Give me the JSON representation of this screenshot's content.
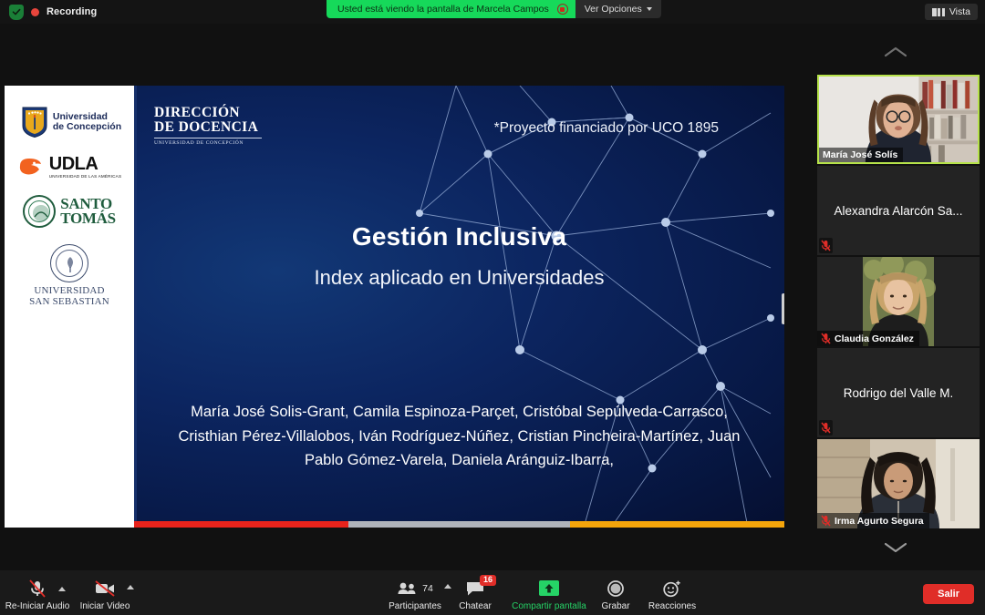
{
  "topbar": {
    "recording_label": "Recording",
    "shield_icon": "security-shield-icon",
    "share_banner_text": "Usted está viendo la pantalla de Marcela Campos",
    "stop_share_icon": "stop-share-icon",
    "view_options_label": "Ver Opciones",
    "view_button_label": "Vista"
  },
  "slide": {
    "logos": [
      {
        "name": "Universidad de Concepción",
        "line1": "Universidad",
        "line2": "de Concepción"
      },
      {
        "name": "UDLA",
        "word": "UDLA",
        "sub": "UNIVERSIDAD DE LAS AMÉRICAS"
      },
      {
        "name": "Santo Tomás",
        "line1": "SANTO",
        "line2": "TOMÁS"
      },
      {
        "name": "Universidad San Sebastián",
        "line1": "UNIVERSIDAD",
        "line2": "SAN SEBASTIAN"
      }
    ],
    "dd_logo_line1": "DIRECCIÓN",
    "dd_logo_line2": "DE DOCENCIA",
    "dd_logo_sub": "UNIVERSIDAD DE CONCEPCIÓN",
    "funding_note": "*Proyecto financiado por UCO 1895",
    "title": "Gestión Inclusiva",
    "subtitle": "Index aplicado en Universidades",
    "authors": "María José Solis-Grant, Camila Espinoza-Parçet, Cristóbal Sepúlveda-Carrasco, Cristhian Pérez-Villalobos, Iván Rodríguez-Núñez, Cristian Pincheira-Martínez, Juan Pablo Gómez-Varela, Daniela Aránguiz-Ibarra,",
    "accent_colors": {
      "red": "#e8231c",
      "gray": "#b0b4bb",
      "amber": "#f4a50b",
      "slide_blue": "#0c2560"
    }
  },
  "participants_panel": {
    "scroll_up_icon": "chevron-up-icon",
    "scroll_down_icon": "chevron-down-icon",
    "tiles": [
      {
        "name": "María José Solís",
        "speaking": true,
        "muted": false,
        "has_video": true
      },
      {
        "name": "Alexandra Alarcón Sa...",
        "speaking": false,
        "muted": true,
        "has_video": false
      },
      {
        "name": "Claudia González",
        "speaking": false,
        "muted": true,
        "has_video": true
      },
      {
        "name": "Rodrigo del Valle M.",
        "speaking": false,
        "muted": true,
        "has_video": false
      },
      {
        "name": "Irma Agurto Segura",
        "speaking": false,
        "muted": true,
        "has_video": true
      }
    ]
  },
  "toolbar": {
    "audio_label": "Re-Iniciar Audio",
    "video_label": "Iniciar Video",
    "participants_label": "Participantes",
    "participants_count": "74",
    "chat_label": "Chatear",
    "chat_badge": "16",
    "share_label": "Compartir pantalla",
    "record_label": "Grabar",
    "reactions_label": "Reacciones",
    "leave_label": "Salir"
  }
}
